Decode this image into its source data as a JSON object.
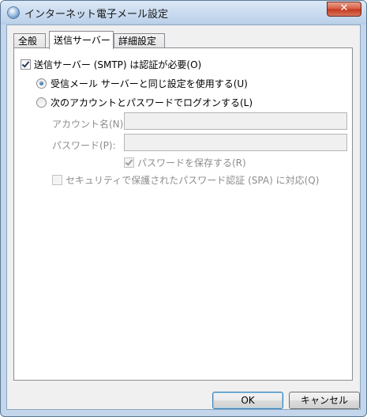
{
  "window": {
    "title": "インターネット電子メール設定",
    "close_label": "✕"
  },
  "tabs": [
    {
      "label": "全般",
      "active": false
    },
    {
      "label": "送信サーバー",
      "active": true
    },
    {
      "label": "詳細設定",
      "active": false
    }
  ],
  "outgoing": {
    "auth_required_label": "送信サーバー (SMTP) は認証が必要(O)",
    "auth_required_checked": true,
    "same_as_incoming_label": "受信メール サーバーと同じ設定を使用する(U)",
    "same_as_incoming_selected": true,
    "logon_with_label": "次のアカウントとパスワードでログオンする(L)",
    "logon_with_selected": false,
    "account_name_label": "アカウント名(N):",
    "account_name_value": "",
    "password_label": "パスワード(P):",
    "password_value": "",
    "remember_password_label": "パスワードを保存する(R)",
    "remember_password_checked": true,
    "spa_label": "セキュリティで保護されたパスワード認証 (SPA) に対応(Q)",
    "spa_checked": false
  },
  "buttons": {
    "ok_label": "OK",
    "cancel_label": "キャンセル"
  }
}
